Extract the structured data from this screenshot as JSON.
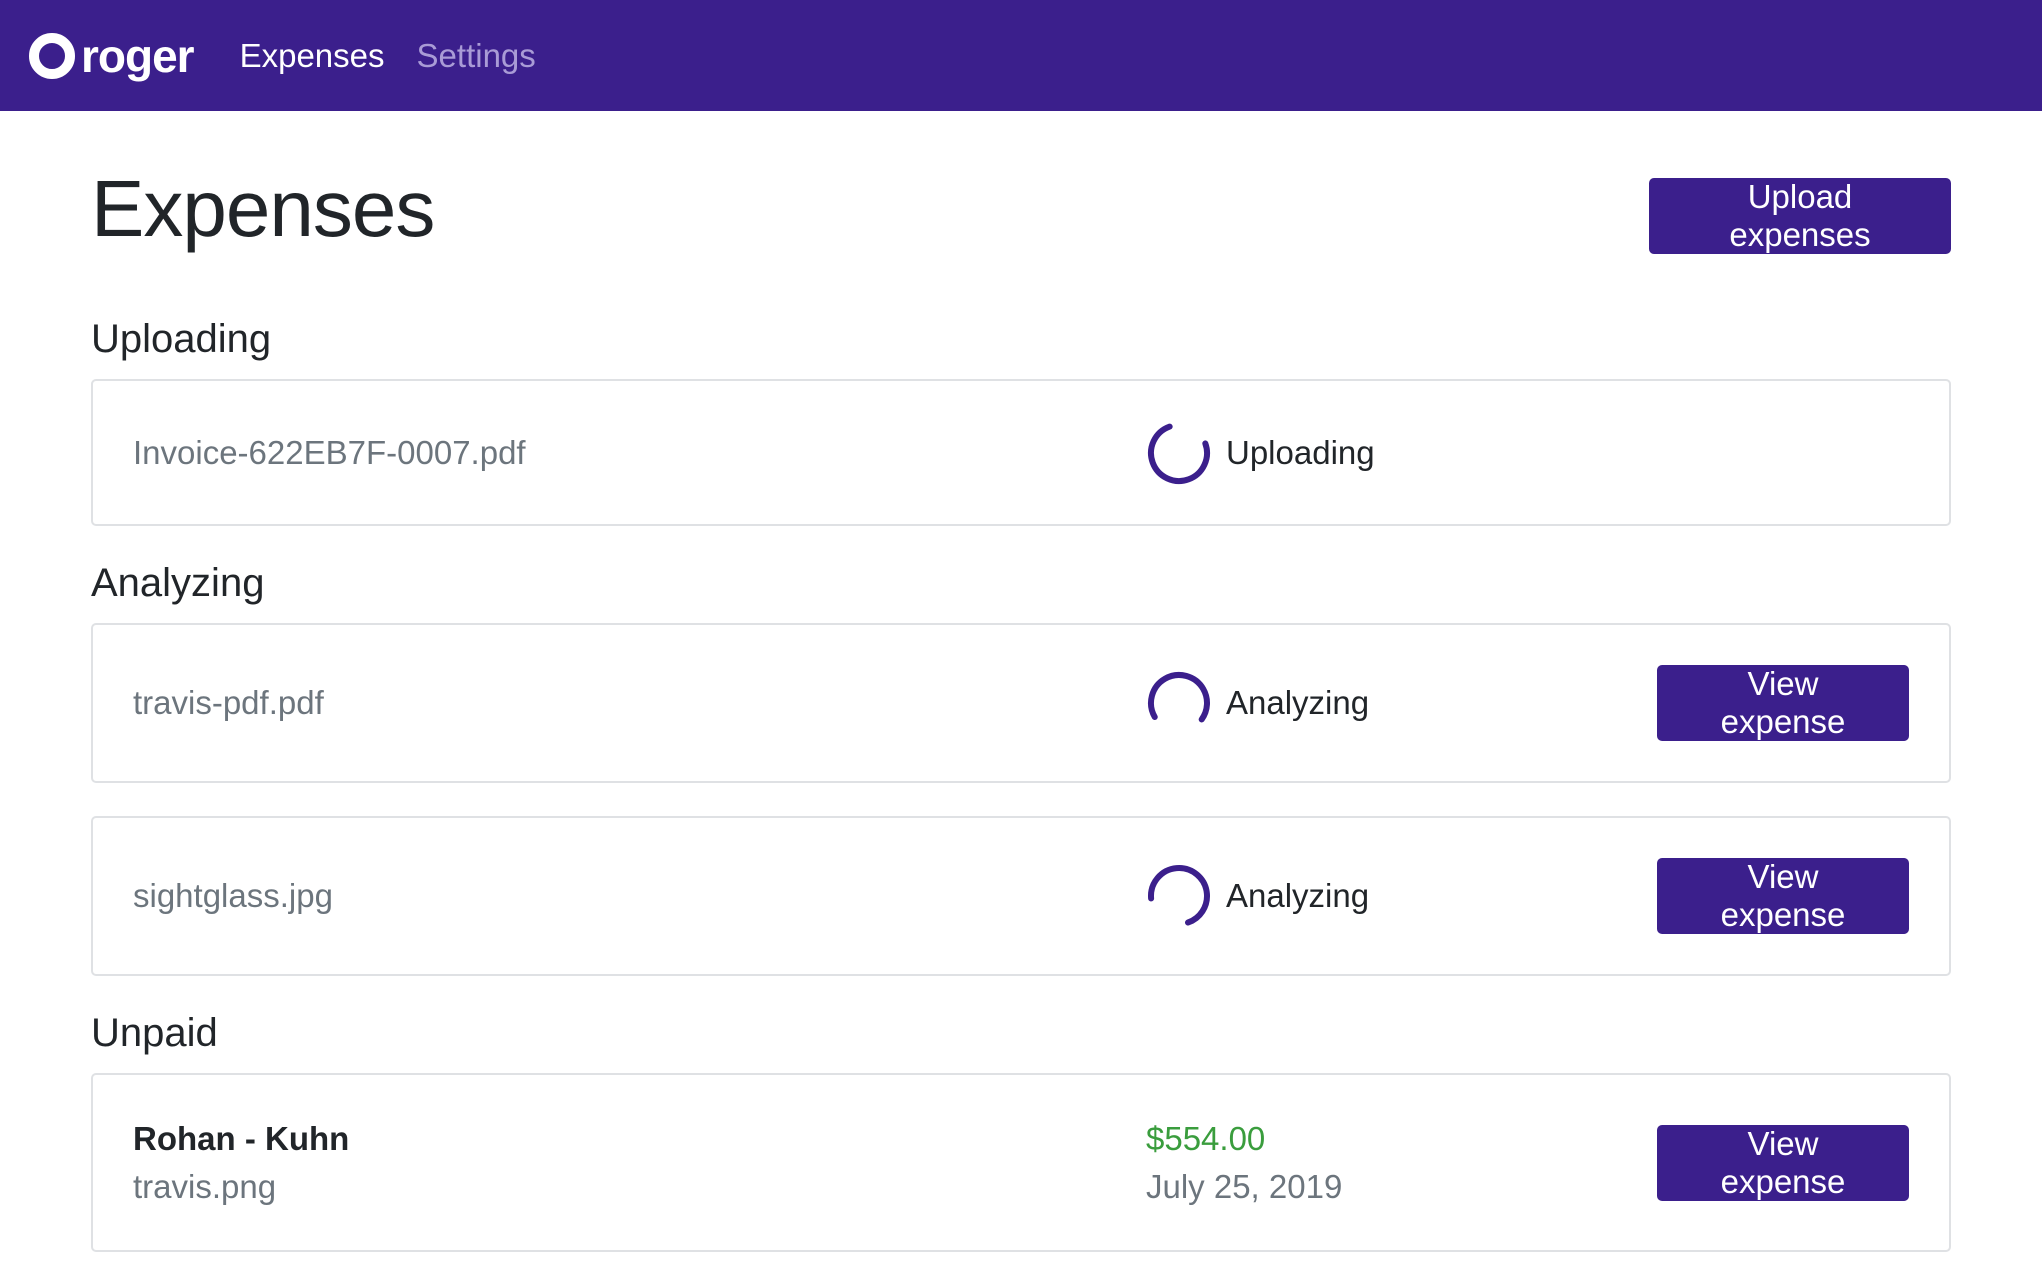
{
  "nav": {
    "brand": "roger",
    "links": [
      {
        "label": "Expenses",
        "active": true
      },
      {
        "label": "Settings",
        "active": false
      }
    ]
  },
  "page": {
    "title": "Expenses",
    "upload_button": "Upload expenses"
  },
  "sections": {
    "uploading": {
      "title": "Uploading",
      "items": [
        {
          "file": "Invoice-622EB7F-0007.pdf",
          "status": "Uploading"
        }
      ]
    },
    "analyzing": {
      "title": "Analyzing",
      "items": [
        {
          "file": "travis-pdf.pdf",
          "status": "Analyzing",
          "action": "View expense"
        },
        {
          "file": "sightglass.jpg",
          "status": "Analyzing",
          "action": "View expense"
        }
      ]
    },
    "unpaid": {
      "title": "Unpaid",
      "items": [
        {
          "vendor": "Rohan - Kuhn",
          "file": "travis.png",
          "amount": "$554.00",
          "date": "July 25, 2019",
          "action": "View expense"
        }
      ]
    }
  },
  "colors": {
    "brand": "#3b1f8c",
    "amount_positive": "#3a9d3d",
    "muted_text": "#6c757d",
    "border": "#dfe1e4"
  }
}
